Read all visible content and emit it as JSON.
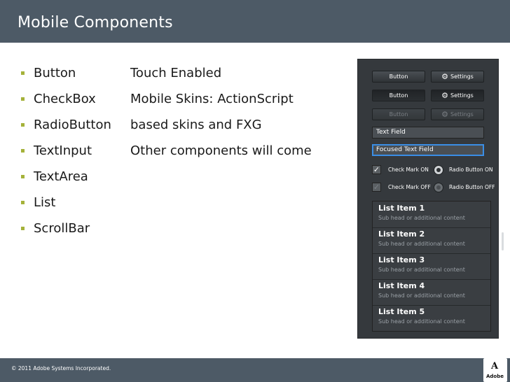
{
  "title": "Mobile Components",
  "bullets": [
    "Button",
    "CheckBox",
    "RadioButton",
    "TextInput",
    "TextArea",
    "List",
    "ScrollBar"
  ],
  "touch": [
    "Touch Enabled",
    "Mobile Skins: ActionScript",
    "based skins and FXG",
    "Other components will come"
  ],
  "panel": {
    "button_label": "Button",
    "settings_label": "Settings",
    "text_field": "Text Field",
    "focused_text_field": "Focused Text Field",
    "check_on": "Check Mark ON",
    "check_off": "Check Mark OFF",
    "radio_on": "Radio Button ON",
    "radio_off": "Radio Button OFF",
    "list": [
      {
        "title": "List Item 1",
        "sub": "Sub head or additional content"
      },
      {
        "title": "List Item 2",
        "sub": "Sub head or additional content"
      },
      {
        "title": "List Item 3",
        "sub": "Sub head or additional content"
      },
      {
        "title": "List Item 4",
        "sub": "Sub head or additional content"
      },
      {
        "title": "List Item 5",
        "sub": "Sub head or additional content"
      }
    ]
  },
  "footer": {
    "copyright": "© 2011 Adobe Systems Incorporated.",
    "logo_text": "Adobe"
  },
  "colors": {
    "bar": "#4d5a66",
    "bullet": "#a5b23a",
    "panel": "#35393d",
    "focus": "#3a8ee6"
  }
}
